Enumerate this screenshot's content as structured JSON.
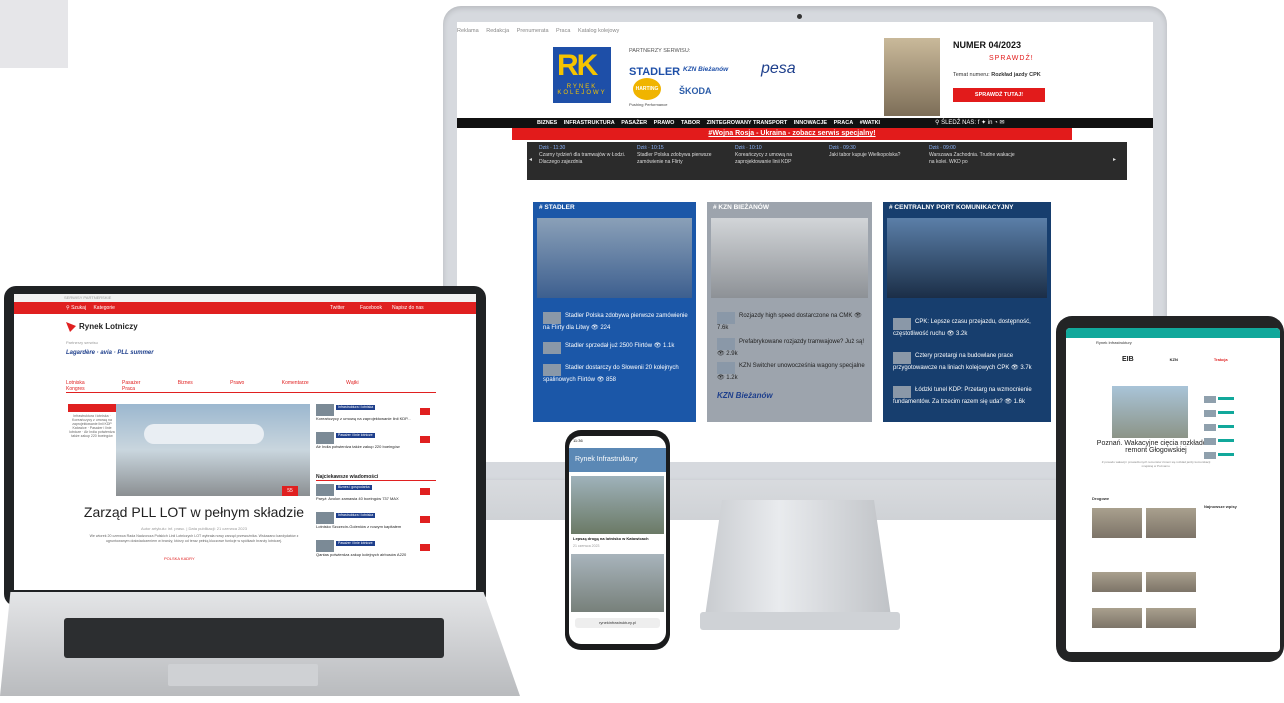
{
  "monitor": {
    "topnav": [
      "Reklama",
      "Redakcja",
      "Prenumerata",
      "Praca",
      "Katalog kolejowy"
    ],
    "logo_text": "RK",
    "logo_sub": "RYNEK KOLEJOWY",
    "partners_label": "PARTNERZY SERWISU:",
    "partner_stadler": "STADLER",
    "partner_kzn": "KZN Bieżanów",
    "partner_pesa": "pesa",
    "partner_harting": "HARTING",
    "partner_harting_sub": "Pushing Performance",
    "partner_skoda": "ŠKODA",
    "issue_title": "NUMER 04/2023",
    "issue_check": "SPRAWDŹ!",
    "issue_topic_label": "Temat numeru:",
    "issue_topic": "Rozkład jazdy CPK",
    "issue_button": "SPRAWDŹ TUTAJ!",
    "menu": [
      "BIZNES",
      "INFRASTRUKTURA",
      "PASAŻER",
      "PRAWO",
      "TABOR",
      "ZINTEGROWANY TRANSPORT",
      "INNOWACJE",
      "PRACA",
      "#WATKI"
    ],
    "follow_label": "ŚLEDŹ NAS:",
    "banner": "#Wojna Rosja - Ukraina - zobacz serwis specjalny!",
    "ticker": [
      {
        "time": "Dziś · 11:30",
        "text": "Czarny tydzień dla tramwajów w Łodzi. Dlaczego zajezdnia"
      },
      {
        "time": "Dziś · 10:15",
        "text": "Stadler Polska zdobywa pierwsze zamówienie na Flirty"
      },
      {
        "time": "Dziś · 10:10",
        "text": "Koreańczycy z umową na zaprojektowanie linii KDP"
      },
      {
        "time": "Dziś · 09:30",
        "text": "Jaki tabor kupuje Wielkopolska?"
      },
      {
        "time": "Dziś · 09:00",
        "text": "Warszawa Zachodnia. Trudne wakacje na kolei. WKD po"
      }
    ],
    "cards": [
      {
        "title": "# STADLER",
        "color": "#1b57a8",
        "items": [
          {
            "text": "Stadler Polska zdobywa pierwsze zamówienie na Flirty dla Litwy",
            "views": "224"
          },
          {
            "text": "Stadler sprzedał już 2500 Flirtów",
            "views": "1.1k"
          },
          {
            "text": "Stadler dostarczy do Słowenii 20 kolejnych spalinowych Flirtów",
            "views": "858"
          }
        ]
      },
      {
        "title": "# KZN BIEŻANÓW",
        "color": "#9da4ad",
        "items": [
          {
            "text": "Rozjazdy high speed dostarczone na CMK",
            "views": "7.6k"
          },
          {
            "text": "Prefabrykowane rozjazdy tramwajowe? Już są!",
            "views": "2.9k"
          },
          {
            "text": "KZN Switcher unowocześnia wagony specjalne",
            "views": "1.2k"
          }
        ],
        "brand": "KZN Bieżanów"
      },
      {
        "title": "# CENTRALNY PORT KOMUNIKACYJNY",
        "color": "#173e6e",
        "items": [
          {
            "text": "CPK: Lepsze czasu przejazdu, dostępność, częstotliwość ruchu",
            "views": "3.2k"
          },
          {
            "text": "Cztery przetargi na budowlane prace przygotowawcze na liniach kolejowych CPK",
            "views": "3.7k"
          },
          {
            "text": "Łódzki tunel KDP: Przetarg na wzmocnienie fundamentów. Za trzecim razem się uda?",
            "views": "1.6k"
          }
        ]
      }
    ]
  },
  "laptop": {
    "topbar": "SERWISY PARTNERSKIE",
    "search": "Szukaj",
    "categories": "Kategorie",
    "social": [
      "Twitter",
      "Facebook",
      "Napisz do nas"
    ],
    "logo": "Rynek Lotniczy",
    "partners_label": "Partnerzy serwisu",
    "partner_logos": "Lagardère · avia · PLL summer",
    "menu": [
      "Lotniska",
      "Pasażer",
      "Biznes",
      "Prawo",
      "Komentarze",
      "Wątki",
      "Kongres",
      "Praca"
    ],
    "side_list": "Infrastruktura i lotniska · Koreańczycy z umową na zaprojektowanie linii KDP Katowice · Pasażer i linie lotnicze · Air India potwierdza także zakup 220 boeingów",
    "count": "55",
    "headline": "Zarząd PLL LOT w pełnym składzie",
    "meta": "Autor artykułu: inf. prasc. | Data publikacji: 21 czerwca 2023",
    "body": "We wtorek 20 czerwca Rada Nadzorcza Polskich Linii Lotniczych LOT wybrała nowy zarząd przewoźnika. Wskazano kandydatów z ugruntowanym doświadczeniem w branży, którzy od teraz pełnią kluczowe funkcje w spółkach branży lotniczej.",
    "tags": [
      "POLSKA",
      "KADRY"
    ],
    "right_items": [
      {
        "badge": "Infrastruktura i lotniska",
        "text": "Koreańczycy z umową na zaprojektowanie linii KDP...",
        "date": "21 czerwca 2023"
      },
      {
        "badge": "Pasażer i linie lotnicze",
        "text": "Air India potwierdza także zakup 220 boeingów",
        "date": "21 czerwca 2023"
      }
    ],
    "section": "Najciekawsze wiadomości",
    "right_items2": [
      {
        "badge": "Biznes i gospodarka",
        "text": "Paryż: Avolon zamawia 40 boeingów 737 MAX",
        "date": "21 czerwca 2023"
      },
      {
        "badge": "Infrastruktura i lotniska",
        "text": "Lotnisko Szczecin-Goleniów z nowym kapitałem",
        "date": "20 czerwca 2023"
      },
      {
        "badge": "Pasażer i linie lotnicze",
        "text": "Qantas potwierdza zakup kolejnych airbusów A220",
        "date": "20 czerwca 2023"
      }
    ]
  },
  "phone": {
    "time": "11:36",
    "site": "Rynek Infrastruktury",
    "caption": "Lepszą drogą na lotnisko w Katowicach",
    "date": "21 czerwca 2023",
    "url": "rynekinfrastruktury.pl"
  },
  "tablet": {
    "logo": "Rynek Infrastruktury",
    "partners": [
      "EIB",
      "KZN",
      "Trakcja"
    ],
    "headline": "Poznań. Wakacyjne cięcia rozkładów i remont Głogowskiej",
    "body": "Z powodu wakacji i prowadzonych remontów zmieni się rozkład jazdy komunikacji miejskiej w Poznaniu.",
    "section": "Drogowe",
    "section2": "Najnowsze wpisy"
  }
}
